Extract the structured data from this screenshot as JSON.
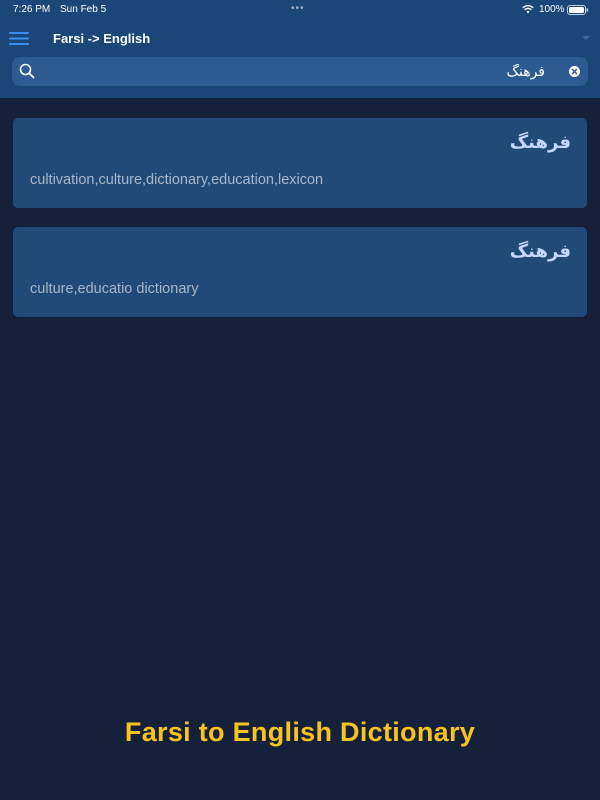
{
  "status_bar": {
    "time": "7:26 PM",
    "date": "Sun Feb 5",
    "dots": "•••",
    "battery": "100%"
  },
  "nav": {
    "title": "Farsi -> English",
    "menu_icon": "hamburger-menu-icon",
    "dropdown_icon": "chevron-down-icon"
  },
  "search": {
    "value": "فرهنگ",
    "placeholder": "",
    "icon": "search-icon",
    "clear_icon": "clear-x-icon"
  },
  "results": [
    {
      "term": "فرهنگ",
      "definition": "cultivation,culture,dictionary,education,lexicon"
    },
    {
      "term": "فرهنگ",
      "definition": "culture,educatio dictionary"
    }
  ],
  "footer": {
    "title": "Farsi to English Dictionary"
  },
  "colors": {
    "header": "#1a4778",
    "background": "#15203b",
    "card": "#214a78",
    "accent_yellow": "#f9c31f",
    "term_text": "#c6d8ff"
  }
}
